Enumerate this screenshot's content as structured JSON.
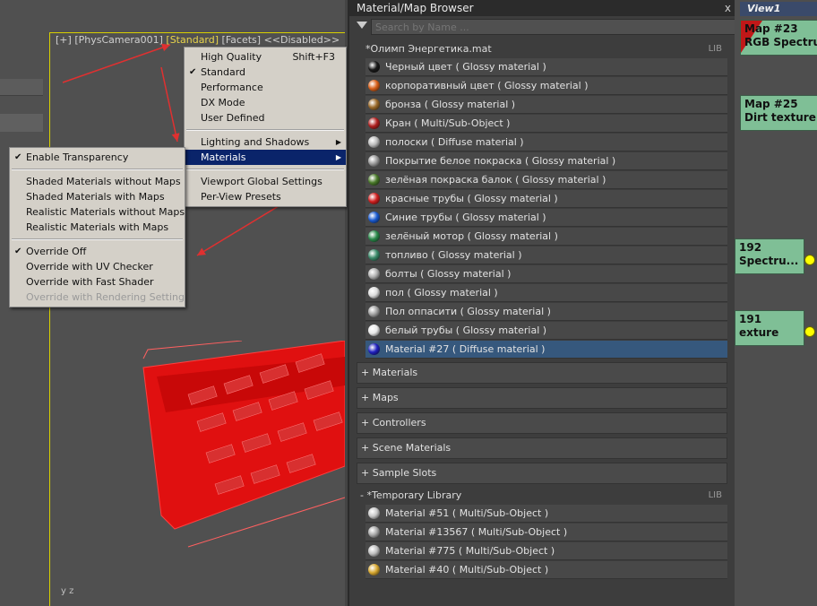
{
  "viewport": {
    "label": {
      "plus": "[+]",
      "camera": "[PhysCamera001]",
      "shading": "[Standard]",
      "facets": "[Facets]",
      "disabled": "<<Disabled>>"
    },
    "axis": "y z"
  },
  "main_menu": {
    "items": [
      {
        "label": "High Quality",
        "shortcut": "Shift+F3"
      },
      {
        "label": "Standard",
        "checked": true
      },
      {
        "label": "Performance"
      },
      {
        "label": "DX Mode"
      },
      {
        "label": "User Defined"
      },
      {
        "label": "Lighting and Shadows",
        "submenu": true
      },
      {
        "label": "Materials",
        "submenu": true,
        "selected": true
      },
      {
        "label": "Viewport Global Settings"
      },
      {
        "label": "Per-View Presets"
      }
    ]
  },
  "sub_menu": {
    "items": [
      {
        "label": "Enable Transparency",
        "checked": true
      },
      {
        "label": "Shaded Materials without Maps"
      },
      {
        "label": "Shaded Materials with Maps"
      },
      {
        "label": "Realistic Materials without Maps"
      },
      {
        "label": "Realistic Materials with Maps"
      },
      {
        "label": "Override Off",
        "checked": true
      },
      {
        "label": "Override with UV Checker"
      },
      {
        "label": "Override with Fast Shader"
      },
      {
        "label": "Override with Rendering Setting",
        "disabled": true
      }
    ]
  },
  "browser": {
    "title": "Material/Map Browser",
    "close": "x",
    "search_placeholder": "Search by Name ...",
    "library": {
      "name": "*Олимп Энергетика.mat",
      "tag": "LIB"
    },
    "materials": [
      {
        "name": "Черный цвет",
        "type": "( Glossy material )",
        "color": "#1a1a1a"
      },
      {
        "name": "корпоративный цвет",
        "type": "( Glossy material )",
        "color": "#d8601a"
      },
      {
        "name": "бронза",
        "type": "( Glossy material )",
        "color": "#9a6a2a"
      },
      {
        "name": "Кран",
        "type": "( Multi/Sub-Object )",
        "color": "#b02020"
      },
      {
        "name": "полоски",
        "type": "( Diffuse material )",
        "color": "#bbbbbb"
      },
      {
        "name": "Покрытие белое покраска",
        "type": "( Glossy material )",
        "color": "#9a9a9a"
      },
      {
        "name": "зелёная покраска балок",
        "type": "( Glossy material )",
        "color": "#4a7a2a"
      },
      {
        "name": "красные трубы",
        "type": "( Glossy material )",
        "color": "#d02020"
      },
      {
        "name": "Синие трубы",
        "type": "( Glossy material )",
        "color": "#1a5ad0"
      },
      {
        "name": "зелёный мотор",
        "type": "( Glossy material )",
        "color": "#2a8a4a"
      },
      {
        "name": "топливо",
        "type": "( Glossy material )",
        "color": "#3a8a6a"
      },
      {
        "name": "болты",
        "type": "( Glossy material )",
        "color": "#b0b0b0"
      },
      {
        "name": "пол",
        "type": "( Glossy material )",
        "color": "#dcdcdc"
      },
      {
        "name": "Пол оппасити",
        "type": "( Glossy material )",
        "color": "#a0a0a0"
      },
      {
        "name": "белый трубы",
        "type": "( Glossy material )",
        "color": "#e8e8e8"
      },
      {
        "name": "Material #27",
        "type": "( Diffuse material )",
        "color": "#2020c0",
        "selected": true
      }
    ],
    "categories": [
      "+ Materials",
      "+ Maps",
      "+ Controllers",
      "+ Scene Materials",
      "+ Sample Slots"
    ],
    "temp_library": {
      "name": "- *Temporary Library",
      "tag": "LIB"
    },
    "temp_materials": [
      {
        "name": "Material #51",
        "type": "( Multi/Sub-Object )",
        "color": "#c8c8c8"
      },
      {
        "name": "Material #13567",
        "type": "( Multi/Sub-Object )",
        "color": "#a8a8a8"
      },
      {
        "name": "Material #775",
        "type": "( Multi/Sub-Object )",
        "color": "#bfbfbf"
      },
      {
        "name": "Material #40",
        "type": "( Multi/Sub-Object )",
        "color": "#d8a830"
      }
    ]
  },
  "nodes": {
    "tab": "View1",
    "items": [
      {
        "line1": "Map #23",
        "line2": "RGB Spectru..."
      },
      {
        "line1": "Map #25",
        "line2": "Dirt texture"
      },
      {
        "line1": "192",
        "line2": "Spectru..."
      },
      {
        "line1": "191",
        "line2": "exture"
      }
    ]
  },
  "colors": {
    "accent_yellow": "#e8d44a",
    "selection_blue": "#0a246a",
    "node_green": "#7fbf96",
    "arrow_red": "#e03030"
  }
}
